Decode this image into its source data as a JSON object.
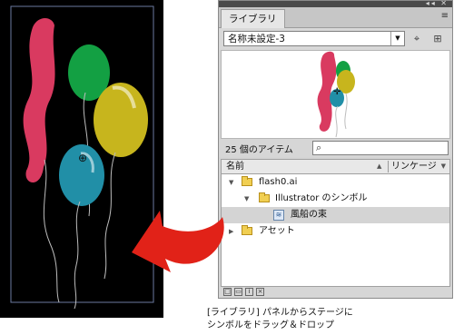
{
  "panel": {
    "tab_label": "ライブラリ",
    "tab_menu_icon": "menu-icon",
    "library_name": "名称未設定-3",
    "pin_icon": "pin-icon",
    "new_library_icon": "new-library-icon",
    "item_count": "25 個のアイテム",
    "search_placeholder": "",
    "header": {
      "name": "名前",
      "linkage": "リンケージ"
    },
    "items": [
      {
        "label": "flash0.ai",
        "type": "folder",
        "level": 0
      },
      {
        "label": "Illustrator のシンボル",
        "type": "folder",
        "level": 1
      },
      {
        "label": "風船の束",
        "type": "symbol",
        "level": 2
      },
      {
        "label": "アセット",
        "type": "folder",
        "level": 0
      }
    ]
  },
  "caption": {
    "line1": "[ライブラリ] パネルからステージに",
    "line2": "シンボルをドラッグ＆ドロップ"
  },
  "colors": {
    "stage_bg": "#000000",
    "arrow": "#e12218",
    "red_balloon": "#d93a60",
    "green_balloon": "#13a043",
    "yellow_balloon": "#c7b51d",
    "teal_balloon": "#218fa7"
  }
}
